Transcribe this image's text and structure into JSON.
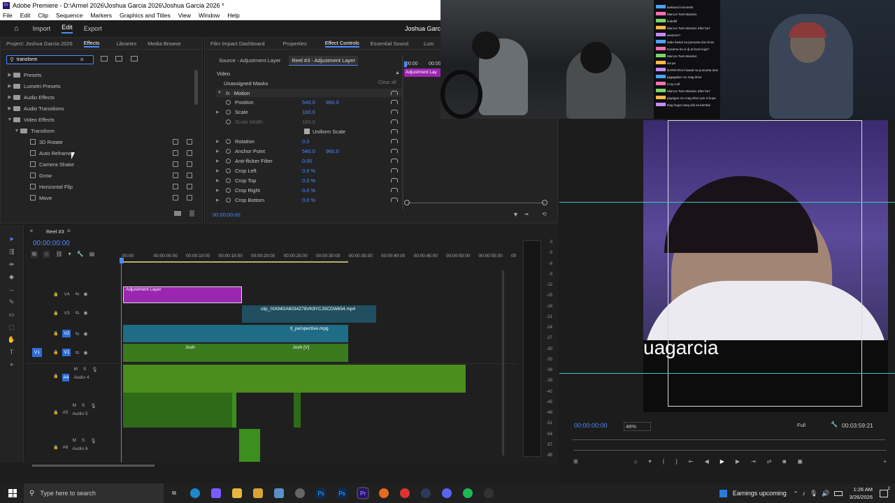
{
  "window": {
    "title": "Adobe Premiere - D:\\Armel 2026\\Joshua Garcia 2026\\Joshua Garcia 2026 *",
    "logo_text": "Pr"
  },
  "menu": [
    "File",
    "Edit",
    "Clip",
    "Sequence",
    "Markers",
    "Graphics and Titles",
    "View",
    "Window",
    "Help"
  ],
  "header": {
    "tabs": [
      "Import",
      "Edit",
      "Export"
    ],
    "active": "Edit",
    "project_name": "Joshua Garc"
  },
  "effects_panel": {
    "tabs": [
      "Project: Joshua Garcia 2026",
      "Effects",
      "Libraries",
      "Media Browse"
    ],
    "search_value": "transform",
    "tree": [
      {
        "label": "Presets",
        "level": 0,
        "type": "folder",
        "open": false
      },
      {
        "label": "Lumetri Presets",
        "level": 0,
        "type": "folder",
        "open": false
      },
      {
        "label": "Audio Effects",
        "level": 0,
        "type": "folder",
        "open": false
      },
      {
        "label": "Audio Transitions",
        "level": 0,
        "type": "folder",
        "open": false
      },
      {
        "label": "Video Effects",
        "level": 0,
        "type": "folder",
        "open": true
      },
      {
        "label": "Transform",
        "level": 1,
        "type": "folder",
        "open": true
      },
      {
        "label": "3D Rotate",
        "level": 2,
        "type": "effect"
      },
      {
        "label": "Auto Reframe",
        "level": 2,
        "type": "effect"
      },
      {
        "label": "Camera Shake",
        "level": 2,
        "type": "effect"
      },
      {
        "label": "Grow",
        "level": 2,
        "type": "effect"
      },
      {
        "label": "Horizontal Flip",
        "level": 2,
        "type": "effect"
      },
      {
        "label": "Move",
        "level": 2,
        "type": "effect"
      }
    ]
  },
  "effect_controls": {
    "tabs": [
      "Film Impact Dashboard",
      "Properties",
      "Effect Controls",
      "Essential Sound",
      "Lum"
    ],
    "source_tab": "Source - Adjustment Layer",
    "reel_tab": "Reel #3 - Adjustment Layer",
    "section": "Video",
    "masks": "Unassigned Masks",
    "clear_all": "Clear all",
    "motion": "Motion",
    "rows": [
      {
        "label": "Position",
        "v1": "540.0",
        "v2": "960.0"
      },
      {
        "label": "Scale",
        "v1": "100.0",
        "v2": ""
      },
      {
        "label": "Scale Width",
        "v1": "100.0",
        "v2": "",
        "dim": true
      },
      {
        "label": "Uniform Scale",
        "checkbox": true
      },
      {
        "label": "Rotation",
        "v1": "0.0",
        "v2": ""
      },
      {
        "label": "Anchor Point",
        "v1": "540.0",
        "v2": "960.0"
      },
      {
        "label": "Anti-flicker Filter",
        "v1": "0.00",
        "v2": ""
      },
      {
        "label": "Crop Left",
        "v1": "0.0 %",
        "v2": ""
      },
      {
        "label": "Crop Top",
        "v1": "0.0 %",
        "v2": ""
      },
      {
        "label": "Crop Right",
        "v1": "0.0 %",
        "v2": ""
      },
      {
        "label": "Crop Bottom",
        "v1": "0.0 %",
        "v2": ""
      }
    ],
    "timecode": "00:00:00:00",
    "mini_time_start": "00:00",
    "mini_time_end": "00:00",
    "mini_clip": "Adjustment Lay"
  },
  "timeline": {
    "sequence_name": "Reel #3",
    "timecode": "00:00:00:00",
    "ruler": [
      ":00:00",
      "00:00:05:00",
      "00:00:10:00",
      "00:00:15:00",
      "00:00:20:00",
      "00:00:25:00",
      "00:00:30:00",
      "00:00:35:00",
      "00:00:40:00",
      "00:00:45:00",
      "00:00:50:00",
      "00:00:55:00",
      "00"
    ],
    "video_tracks": [
      "V4",
      "V3",
      "V2",
      "V1"
    ],
    "audio_tracks": [
      {
        "id": "A4",
        "name": "Audio 4"
      },
      {
        "id": "A5",
        "name": "Audio 5"
      },
      {
        "id": "A6",
        "name": "Audio 6"
      }
    ],
    "source_label": "V1",
    "clips": {
      "adjustment": "Adjustment Layer",
      "v3_clip": "clip_01KMGA6034Z78VK8YCJSCDW654.mp4",
      "v2_clip": "tl_perspective.mpg",
      "v1_a": "Josh",
      "v1_b": "Josh [V]",
      "fx": "fx"
    },
    "meter_labels": [
      "0",
      "-3",
      "-6",
      "-9",
      "-12",
      "-15",
      "-18",
      "-21",
      "-24",
      "-27",
      "-30",
      "-33",
      "-36",
      "-39",
      "-42",
      "-45",
      "-48",
      "-51",
      "-54",
      "-57",
      "dB"
    ]
  },
  "program": {
    "overlay_text": "uagarcia",
    "timecode": "00:00:00:00",
    "zoom": "48%",
    "quality": "Full",
    "duration": "00:03:59:21"
  },
  "chat_lines": [
    "awkward moments",
    "Marcos Twin Mandon",
    "kobefill",
    "Marcos Twin Mandon after ba?",
    "westone?",
    "sabe bawal na pumunta don boss",
    "Kasama ba ni dj at boss kuja?",
    "Marcos Twin Mandon",
    "isa pa",
    "NARRARAH bawal na pumunta doon",
    "pagagalan mo mag drive",
    "Crop Left",
    "Marcos Twin Mandon after ba?",
    "payagan mo mag drive yan si kuya",
    "Nag hugot nang sila sa kambal"
  ],
  "taskbar": {
    "search_placeholder": "Type here to search",
    "weather": "Earnings upcoming",
    "time": "1:26 AM",
    "date": "3/26/2026",
    "notif": "2"
  },
  "colors": {
    "accent": "#4a8cff",
    "adjustment": "#9b27b0",
    "video_clip": "#1f6c86",
    "v1_clip": "#3a7a1f",
    "audio_clip": "#4a8e1e",
    "track_active": "#2d6fd4"
  }
}
